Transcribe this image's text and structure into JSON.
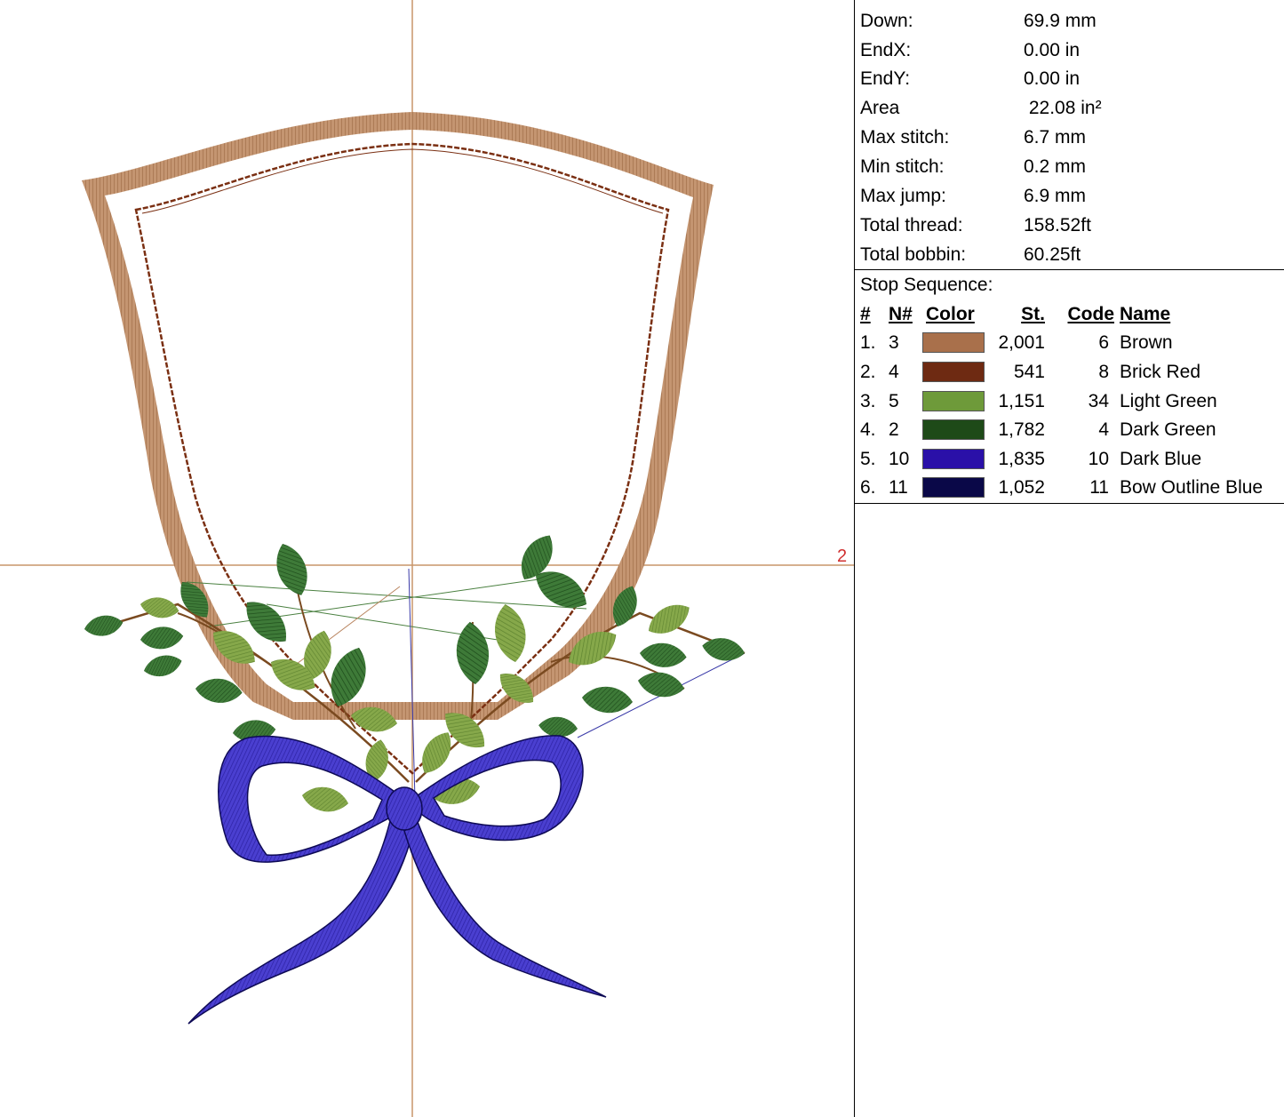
{
  "canvas": {
    "crosshair_label": "2",
    "colors": {
      "guide": "#c8956a",
      "frame_outer": "#b98560",
      "frame_inner": "#7a2f12",
      "leaf_light": "#7a9a3a",
      "leaf_dark": "#2e6a2a",
      "bow": "#3a2fb0",
      "bow_outline": "#0e0a55",
      "jump": "#3a3aa8"
    }
  },
  "stats": [
    {
      "label": "Down:",
      "value": "69.9 mm"
    },
    {
      "label": "EndX:",
      "value": "0.00 in"
    },
    {
      "label": "EndY:",
      "value": "0.00 in"
    },
    {
      "label": "Area",
      "value": " 22.08 in²"
    },
    {
      "label": "Max stitch:",
      "value": "6.7 mm"
    },
    {
      "label": "Min stitch:",
      "value": "0.2 mm"
    },
    {
      "label": "Max jump:",
      "value": "6.9 mm"
    },
    {
      "label": "Total thread:",
      "value": "158.52ft"
    },
    {
      "label": "Total bobbin:",
      "value": "60.25ft"
    }
  ],
  "stop_sequence": {
    "title": "Stop Sequence:",
    "headers": {
      "idx": "#",
      "n": "N#",
      "color": "Color",
      "st": "St.",
      "code": "Code",
      "name": "Name"
    },
    "rows": [
      {
        "idx": "1.",
        "n": "3",
        "color": "#a9704b",
        "st": "2,001",
        "code": "6",
        "name": "Brown"
      },
      {
        "idx": "2.",
        "n": "4",
        "color": "#6e2a12",
        "st": "541",
        "code": "8",
        "name": "Brick Red"
      },
      {
        "idx": "3.",
        "n": "5",
        "color": "#6e9a3a",
        "st": "1,151",
        "code": "34",
        "name": "Light Green"
      },
      {
        "idx": "4.",
        "n": "2",
        "color": "#1e4a18",
        "st": "1,782",
        "code": "4",
        "name": "Dark Green"
      },
      {
        "idx": "5.",
        "n": "10",
        "color": "#2a10a8",
        "st": "1,835",
        "code": "10",
        "name": "Dark Blue"
      },
      {
        "idx": "6.",
        "n": "11",
        "color": "#0a0848",
        "st": "1,052",
        "code": "11",
        "name": "Bow Outline Blue"
      }
    ]
  }
}
